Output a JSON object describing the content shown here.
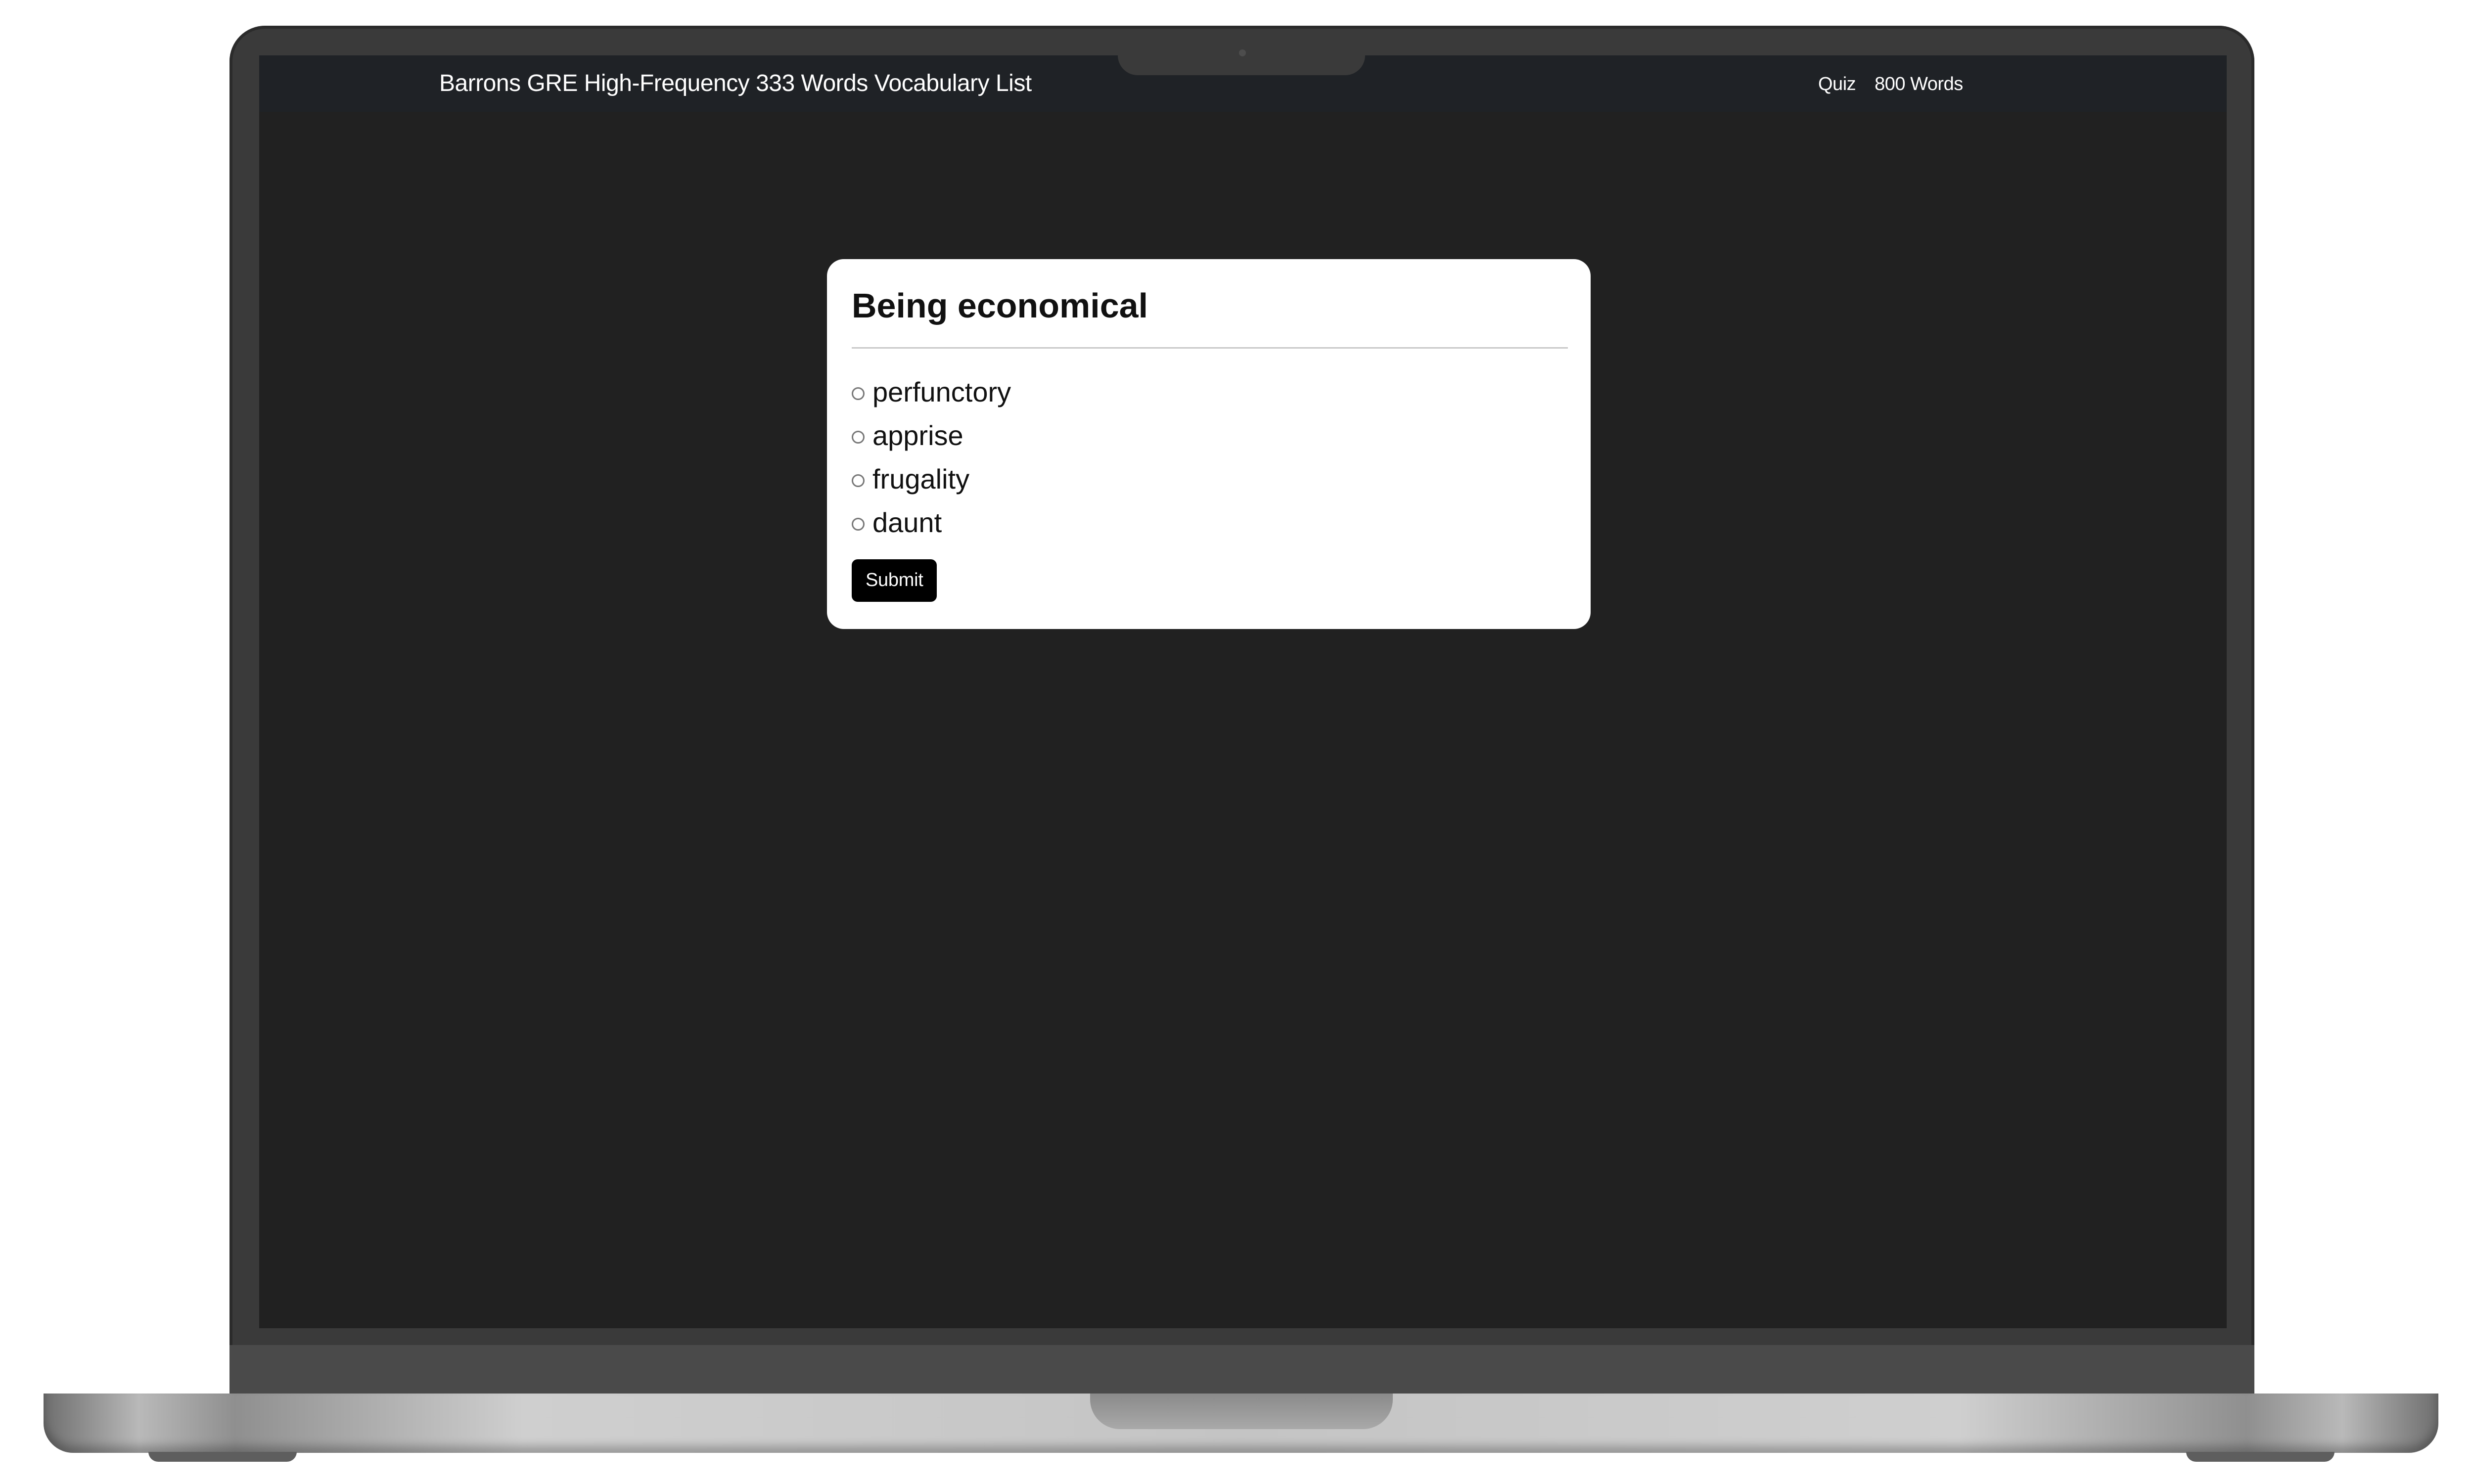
{
  "app": {
    "title": "Barrons GRE High-Frequency 333 Words Vocabulary List"
  },
  "nav": {
    "links": [
      {
        "label": "Quiz"
      },
      {
        "label": "800 Words"
      }
    ]
  },
  "quiz": {
    "question": "Being economical",
    "options": [
      {
        "label": "perfunctory",
        "selected": false
      },
      {
        "label": "apprise",
        "selected": false
      },
      {
        "label": "frugality",
        "selected": false
      },
      {
        "label": "daunt",
        "selected": false
      }
    ],
    "submit_label": "Submit"
  },
  "colors": {
    "screen_background": "#212121",
    "navbar_background": "#1f2226",
    "card_background": "#ffffff",
    "button_background": "#000000"
  }
}
